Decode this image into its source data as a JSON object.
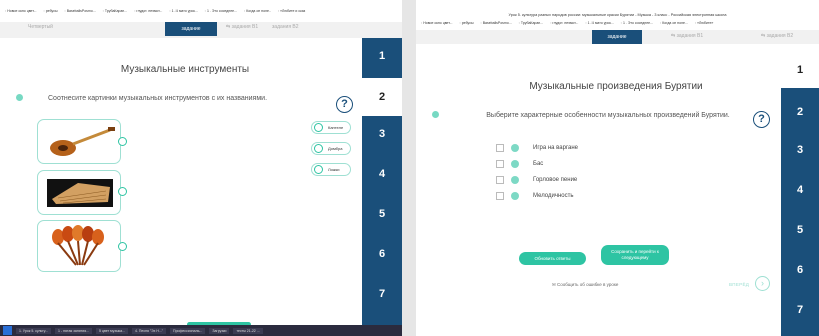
{
  "left": {
    "bookmarks": [
      "Новое окно цвет...",
      "ребусы",
      "BaseballsPosmo...",
      "ТрубаКаран...",
      "глудот. пеэмот...",
      "1 -Ч мато урок...",
      "1 . Это соседнее...",
      "Когда он поле..",
      "«Любите и сказ"
    ],
    "tabs": {
      "prev": "Четвертый\nзадание",
      "current": "задание",
      "next": "задания В2",
      "prev2": "задания В1"
    },
    "title": "Музыкальные инструменты",
    "question": "Соотнесите картинки музыкальных инструментов с их названиями.",
    "help": "?",
    "answers": [
      "Кантеле",
      "Домбра",
      "Ложки"
    ],
    "nav": [
      "1",
      "2",
      "3",
      "4",
      "5",
      "6",
      "7"
    ],
    "active_nav": "2",
    "taskbar": [
      "1. Урок 5. культу...",
      "1 - пятая занятия...",
      "5 цвет музыка...",
      "4. Песня \"Эх Н...\"",
      "Профессиональ...",
      "Загрузки",
      "тесты 21-22 ..."
    ]
  },
  "right": {
    "window_title": "Урок 5. культура разных народов россии: музыкальные краски Бурятии - Музыка - 3 класс - Российская электронная школа",
    "bookmarks": [
      "Новое окно цвет...",
      "ребусы",
      "BaseballsPosmo...",
      "ТрубаКаран...",
      "глудот. пеэмот...",
      "1 -Ч мато урок...",
      "1 . Это соседнее...",
      "Когда он поле...",
      "«Любите»"
    ],
    "tabs": {
      "current": "задание",
      "b1": "задания В1",
      "b2": "задания В2"
    },
    "title": "Музыкальные произведения Бурятии",
    "question": "Выберите характерные особенности музыкальных произведений Бурятии.",
    "help": "?",
    "options": [
      "Игра на варгане",
      "Бас",
      "Горловое пение",
      "Мелодичность"
    ],
    "buttons": {
      "reset": "Обновить ответы",
      "save": "Сохранить и перейти к следующему"
    },
    "next": "ВПЕРЁД",
    "report": "Сообщить об ошибке в уроке",
    "nav": [
      "1",
      "2",
      "3",
      "4",
      "5",
      "6",
      "7"
    ],
    "active_nav": "1"
  }
}
